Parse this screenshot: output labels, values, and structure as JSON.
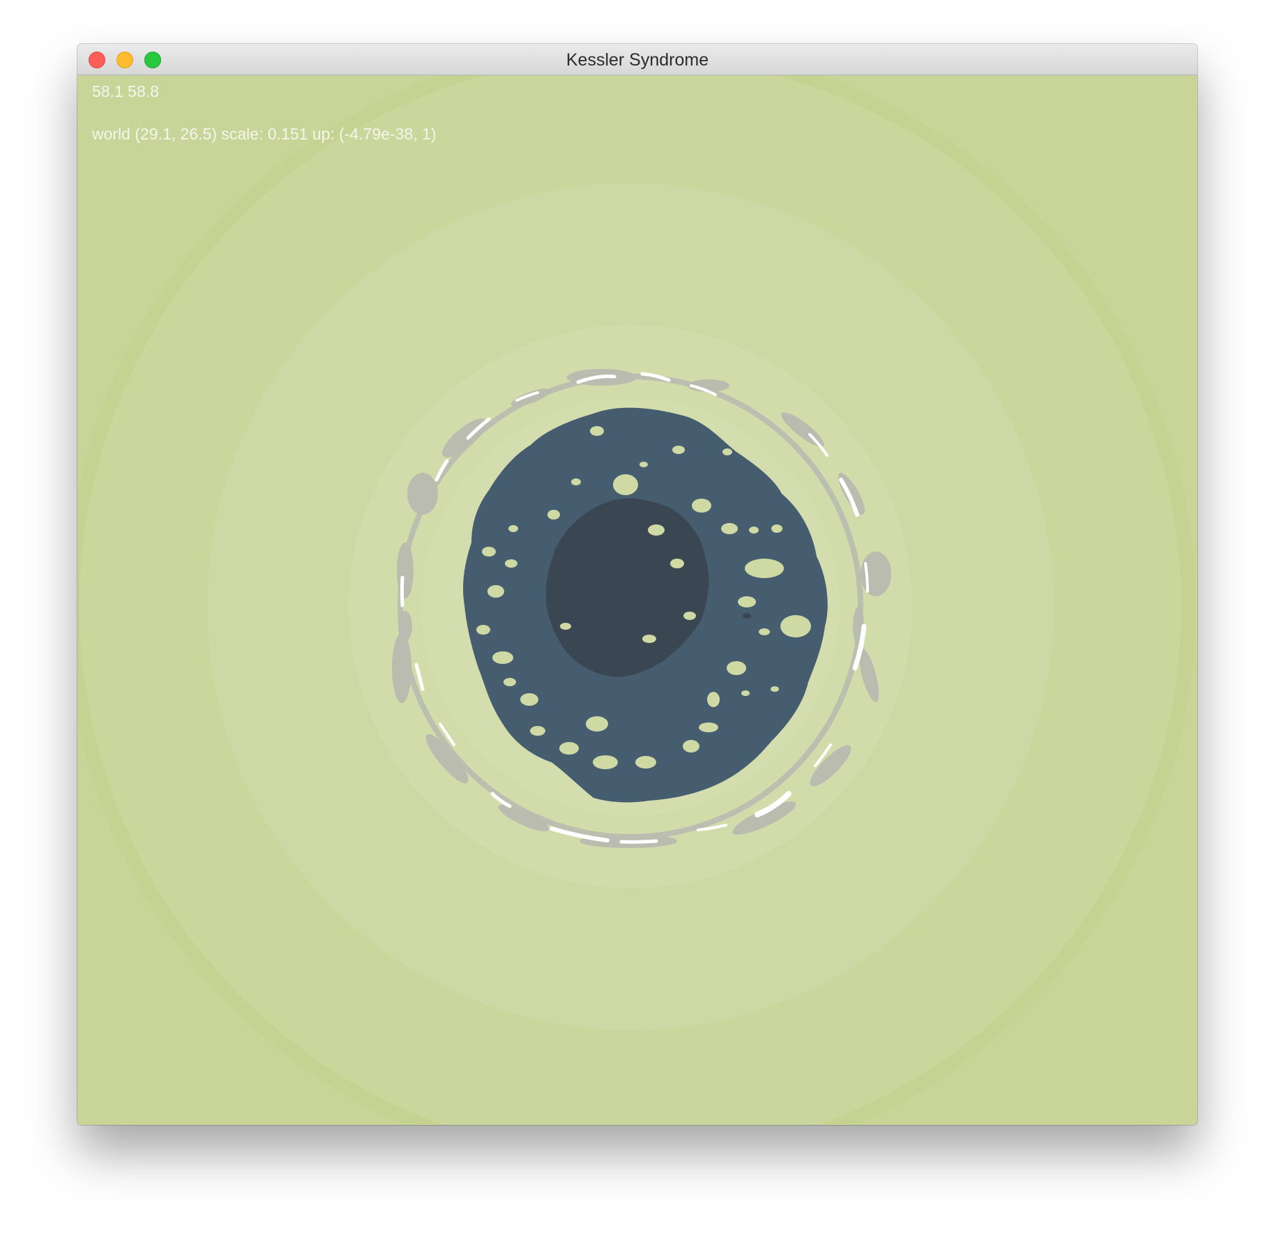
{
  "window": {
    "title": "Kessler Syndrome"
  },
  "hud": {
    "fps_text": "58.1 58.8",
    "world_text": "world (29.1, 26.5) scale: 0.151 up: (-4.79e-38, 1)"
  },
  "colors": {
    "sky_outer": "#c6d292",
    "sky_ring_1": "#cad69c",
    "sky_ring_2": "#cdd9a4",
    "sky_ring_3": "#d1dcaa",
    "sky_inner": "#d3ddad",
    "planet_mantle": "#465d70",
    "planet_core": "#3a4652",
    "debris_gray": "#b7baaa",
    "debris_white": "#ffffff",
    "hud_text": "#f4f6ec"
  }
}
